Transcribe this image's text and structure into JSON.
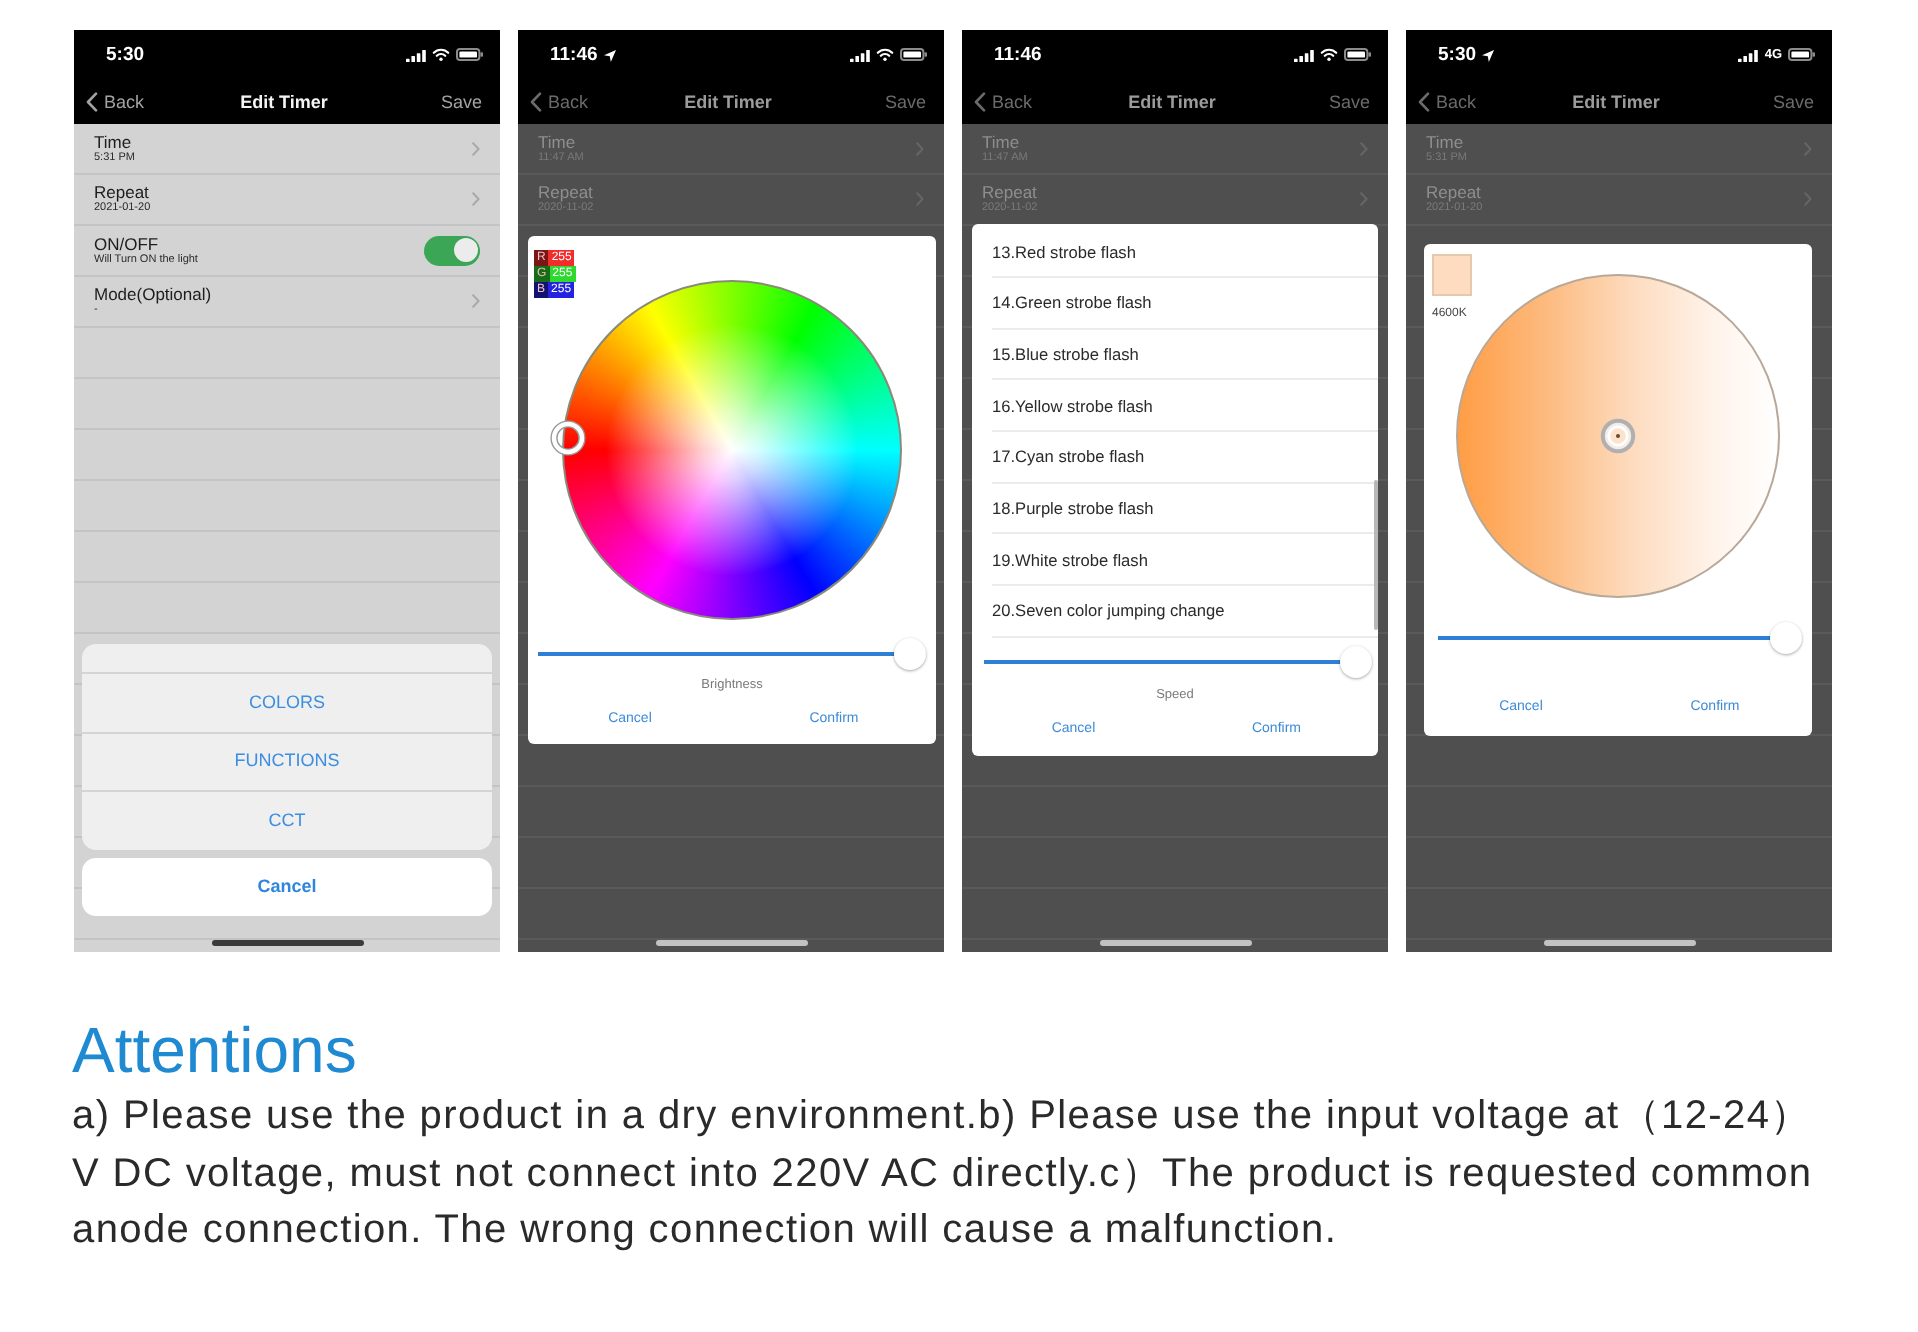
{
  "phones": [
    {
      "status_bar": {
        "time": "5:30",
        "location_arrow": false,
        "wifi": true
      },
      "nav_bar": {
        "back": "Back",
        "title": "Edit Timer",
        "action": "Save"
      },
      "rows": [
        {
          "kind": "link",
          "title": "Time",
          "detail": "5:31 PM"
        },
        {
          "kind": "link",
          "title": "Repeat",
          "detail": "2021-01-20"
        },
        {
          "kind": "switch",
          "title": "ON/OFF",
          "detail": "Will Turn ON the light",
          "on": true
        },
        {
          "kind": "link",
          "title": "Mode(Optional)",
          "detail": "-"
        }
      ],
      "dialog": {
        "kind": "action_sheet",
        "options": [
          "COLORS",
          "FUNCTIONS",
          "CCT"
        ],
        "cancel": "Cancel"
      }
    },
    {
      "status_bar": {
        "time": "11:46",
        "location_arrow": true,
        "wifi": true
      },
      "nav_bar": {
        "back": "Back",
        "title": "Edit Timer",
        "action": "Save"
      },
      "rows": [
        {
          "kind": "link",
          "title": "Time",
          "detail": "11:47 AM"
        },
        {
          "kind": "link",
          "title": "Repeat",
          "detail": "2020-11-02"
        }
      ],
      "dialog": {
        "kind": "color_wheel",
        "readouts": [
          {
            "channel": "R",
            "value": "255",
            "color": "#f22b2b"
          },
          {
            "channel": "G",
            "value": "255",
            "color": "#2fd92f"
          },
          {
            "channel": "B",
            "value": "255",
            "color": "#2424e0"
          }
        ],
        "slider": {
          "label": "Brightness",
          "level": 1
        },
        "cancel": "Cancel",
        "confirm": "Confirm"
      }
    },
    {
      "status_bar": {
        "time": "11:46",
        "location_arrow": false,
        "wifi": true
      },
      "nav_bar": {
        "back": "Back",
        "title": "Edit Timer",
        "action": "Save"
      },
      "rows": [
        {
          "kind": "link",
          "title": "Time",
          "detail": "11:47 AM"
        },
        {
          "kind": "link",
          "title": "Repeat",
          "detail": "2020-11-02"
        }
      ],
      "dialog": {
        "kind": "function_list",
        "items": [
          "13.Red strobe flash",
          "14.Green strobe flash",
          "15.Blue strobe flash",
          "16.Yellow strobe flash",
          "17.Cyan strobe flash",
          "18.Purple strobe flash",
          "19.White strobe flash",
          "20.Seven color jumping change"
        ],
        "slider": {
          "label": "Speed",
          "level": 1
        },
        "cancel": "Cancel",
        "confirm": "Confirm"
      }
    },
    {
      "status_bar": {
        "time": "5:30",
        "location_arrow": true,
        "wifi": false,
        "network": "4G"
      },
      "nav_bar": {
        "back": "Back",
        "title": "Edit Timer",
        "action": "Save"
      },
      "rows": [
        {
          "kind": "link",
          "title": "Time",
          "detail": "5:31 PM"
        },
        {
          "kind": "link",
          "title": "Repeat",
          "detail": "2021-01-20"
        }
      ],
      "dialog": {
        "kind": "cct",
        "swatch": {
          "color": "#fddcc0"
        },
        "temperature": "4600K",
        "slider": {
          "level": 1
        },
        "cancel": "Cancel",
        "confirm": "Confirm"
      }
    }
  ],
  "attentions": {
    "title": "Attentions",
    "text": "a) Please use the product in a dry environment.b) Please use the input voltage at（12-24）V DC voltage, must not connect into 220V AC directly.c）The product is requested common anode connection. The wrong connection will cause a malfunction."
  }
}
